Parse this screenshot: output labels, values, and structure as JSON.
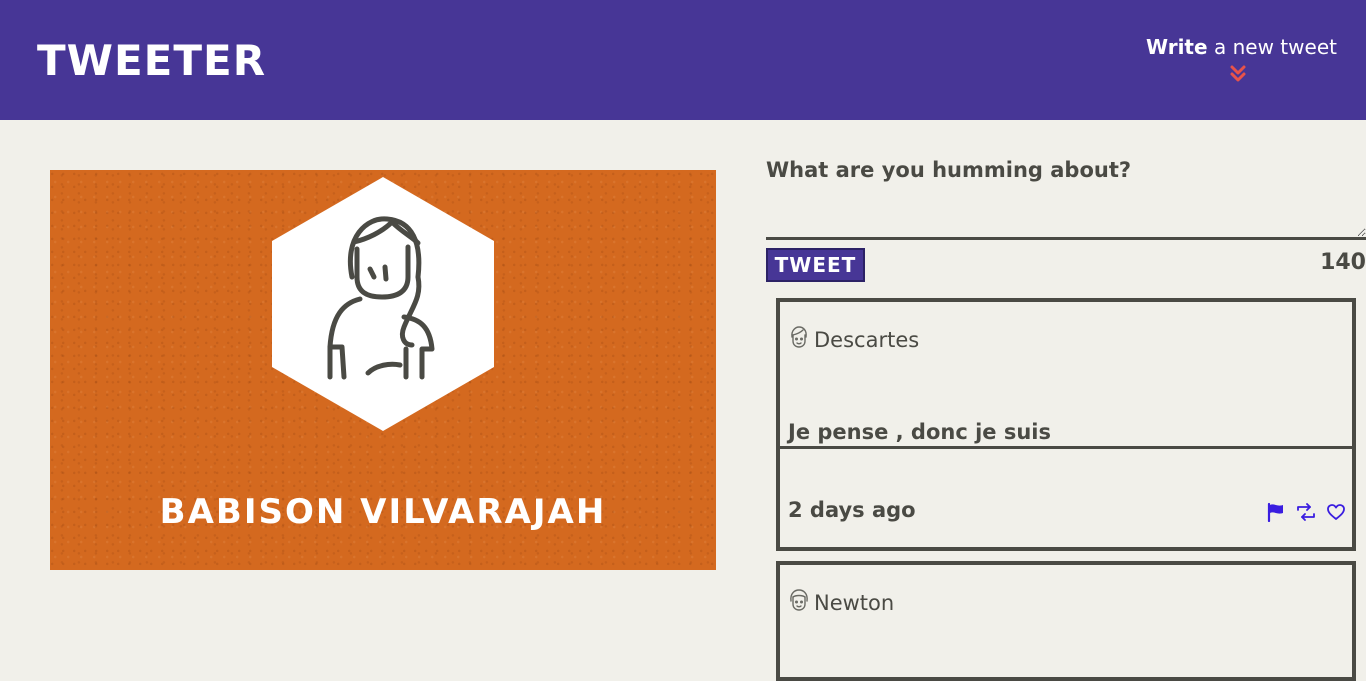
{
  "nav": {
    "brand": "Tweeter",
    "compose_strong": "Write",
    "compose_rest": "a new tweet",
    "chevron_icon": "double-chevron-down-icon"
  },
  "colors": {
    "nav_bg": "#473696",
    "page_bg": "#f1f0ea",
    "profile_bg": "#d4691f",
    "chevron": "#e8534a",
    "action_icons": "#3a1de0",
    "text": "#4a4a44"
  },
  "profile": {
    "name": "Babison Vilvarajah",
    "avatar_icon": "woman-avatar-icon"
  },
  "composer": {
    "placeholder": "What are you humming about?",
    "value": "",
    "button_label": "Tweet",
    "counter": "140"
  },
  "tweets": [
    {
      "user": "Descartes",
      "avatar_icon": "man-avatar-icon",
      "content": "Je pense , donc je suis",
      "timestamp": "2 days ago",
      "actions": [
        "flag-icon",
        "retweet-icon",
        "heart-icon"
      ]
    },
    {
      "user": "Newton",
      "avatar_icon": "man-avatar-icon"
    }
  ]
}
